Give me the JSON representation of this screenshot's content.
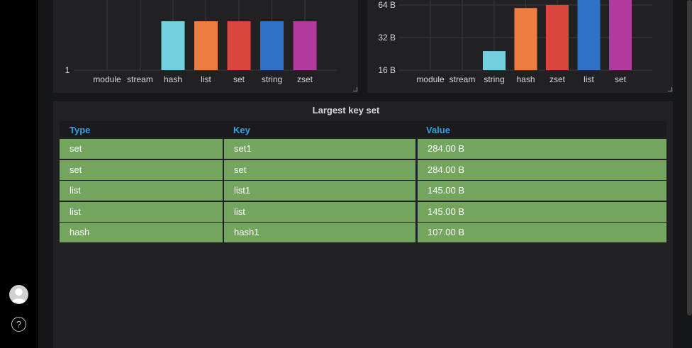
{
  "left_chart": {
    "chart_data": {
      "type": "bar",
      "categories": [
        "module",
        "stream",
        "hash",
        "list",
        "set",
        "string",
        "zset"
      ],
      "values": [
        0,
        0,
        1,
        1,
        1,
        1,
        1
      ],
      "y_ticks": [
        "1"
      ],
      "colors": [
        "#73d0e0",
        "#73d0e0",
        "#73d0e0",
        "#ec7f3f",
        "#d8463e",
        "#2f71c6",
        "#b2399e"
      ]
    }
  },
  "right_chart": {
    "chart_data": {
      "type": "bar",
      "categories": [
        "module",
        "stream",
        "string",
        "hash",
        "zset",
        "list",
        "set"
      ],
      "values_bytes": [
        0,
        0,
        24,
        60,
        64,
        107,
        107
      ],
      "y_ticks": [
        "64 B",
        "32 B",
        "16 B"
      ],
      "y_scale": "log2",
      "colors": [
        "#73d0e0",
        "#73d0e0",
        "#73d0e0",
        "#ec7f3f",
        "#d8463e",
        "#2f71c6",
        "#b2399e"
      ]
    }
  },
  "table": {
    "title": "Largest key set",
    "headers": {
      "type": "Type",
      "key": "Key",
      "value": "Value"
    },
    "rows": [
      {
        "type": "set",
        "key": "set1",
        "value": "284.00 B"
      },
      {
        "type": "set",
        "key": "set",
        "value": "284.00 B"
      },
      {
        "type": "list",
        "key": "list1",
        "value": "145.00 B"
      },
      {
        "type": "list",
        "key": "list",
        "value": "145.00 B"
      },
      {
        "type": "hash",
        "key": "hash1",
        "value": "107.00 B"
      }
    ],
    "row_color": "#73a55f",
    "header_color": "#33a2e5"
  },
  "sidebar": {
    "avatar_icon": "user-avatar-icon",
    "help_icon": "question-mark-icon",
    "help_glyph": "?"
  }
}
